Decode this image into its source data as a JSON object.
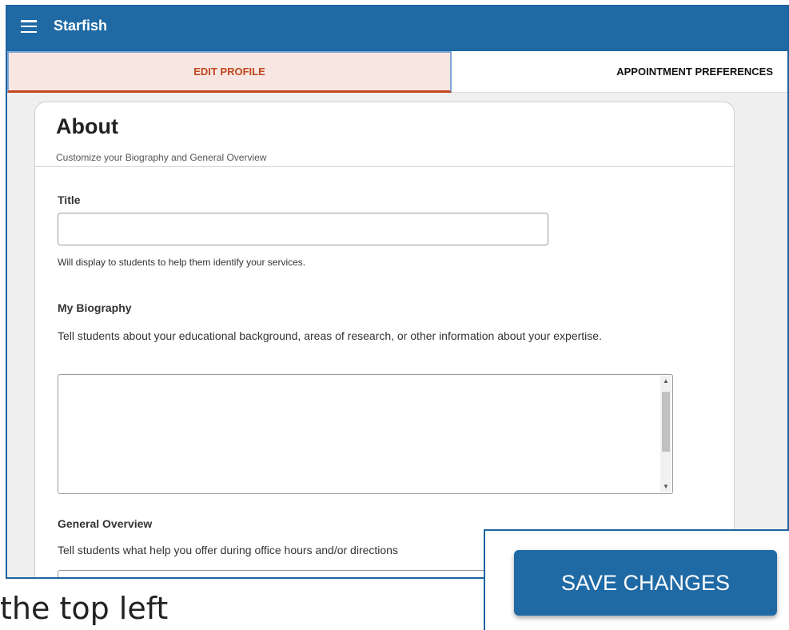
{
  "app": {
    "title": "Starfish"
  },
  "tabs": [
    {
      "label": "EDIT PROFILE",
      "active": true
    },
    {
      "label": "APPOINTMENT PREFERENCES",
      "active": false
    }
  ],
  "about": {
    "heading": "About",
    "subtitle": "Customize your Biography and General Overview",
    "title_field": {
      "label": "Title",
      "value": "",
      "help": "Will display to students to help them identify your services."
    },
    "biography": {
      "label": "My Biography",
      "description": "Tell students about your educational background, areas of research, or other information about your expertise."
    },
    "overview": {
      "label": "General Overview",
      "description": "Tell students what help you offer during office hours and/or directions"
    }
  },
  "save_button": {
    "label": "SAVE CHANGES"
  },
  "caption_fragment": "the top left",
  "colors": {
    "brand": "#1f6aa5",
    "active_tab_text": "#c2461e",
    "active_tab_bg": "#f7e6e1"
  },
  "icons": {
    "menu": "hamburger-icon",
    "scroll_up": "chevron-up-icon",
    "scroll_down": "chevron-down-icon"
  }
}
